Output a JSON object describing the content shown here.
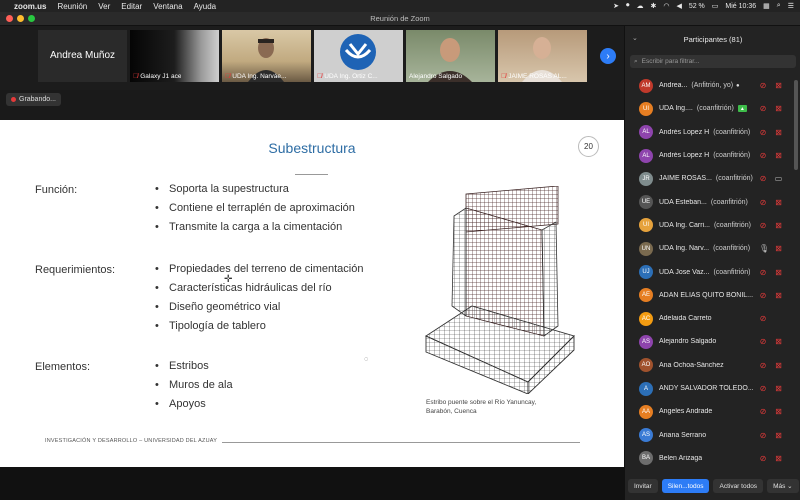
{
  "menubar": {
    "app": "zoom.us",
    "items": [
      "Reunión",
      "Ver",
      "Editar",
      "Ventana",
      "Ayuda"
    ],
    "battery": "52 %",
    "clock": "Mié 10:36"
  },
  "window": {
    "title": "Reunión de Zoom"
  },
  "videos": [
    {
      "name": "Andrea Muñoz",
      "big": true,
      "muted": false
    },
    {
      "name": "Galaxy J1 ace",
      "big": false,
      "muted": true
    },
    {
      "name": "UDA Ing. Narváe...",
      "big": false,
      "muted": true
    },
    {
      "name": "UDA Ing. Ortiz C...",
      "big": false,
      "muted": true
    },
    {
      "name": "Alejandro Salgado",
      "big": false,
      "muted": false
    },
    {
      "name": "JAIME ROSAS AL...",
      "big": false,
      "muted": true
    }
  ],
  "recording": {
    "label": "Grabando..."
  },
  "slide": {
    "title": "Subestructura",
    "page": "20",
    "sections": [
      {
        "label": "Función:",
        "bullets": [
          "Soporta la supestructura",
          "Contiene el terraplén de aproximación",
          "Transmite la carga a la cimentación"
        ]
      },
      {
        "label": "Requerimientos:",
        "bullets": [
          "Propiedades del terreno de cimentación",
          "Características hidráulicas del río",
          "Diseño geométrico vial",
          "Tipología de tablero"
        ]
      },
      {
        "label": "Elementos:",
        "bullets": [
          "Estribos",
          "Muros de ala",
          "Apoyos"
        ]
      }
    ],
    "caption_line1": "Estribo puente sobre el Río Yanuncay,",
    "caption_line2": "Barabón, Cuenca",
    "footer": "INVESTIGACIÓN Y DESARROLLO – UNIVERSIDAD DEL AZUAY"
  },
  "participants": {
    "header": "Participantes (81)",
    "search_placeholder": "Escribir para filtrar...",
    "list": [
      {
        "initials": "AM",
        "color": "#c0392b",
        "name": "Andrea...",
        "role": "(Anfitrión, yo)",
        "mic": "off",
        "cam": "off",
        "extra": "dot"
      },
      {
        "initials": "UI",
        "color": "#e67e22",
        "name": "UDA Ing....",
        "role": "(coanfitrión)",
        "mic": "off",
        "cam": "off",
        "extra": "share"
      },
      {
        "initials": "AL",
        "color": "#8e44ad",
        "name": "Andrés Lopez H",
        "role": "(coanfitrión)",
        "mic": "off",
        "cam": "off",
        "extra": ""
      },
      {
        "initials": "AL",
        "color": "#8e44ad",
        "name": "Andrés Lopez H",
        "role": "(coanfitrión)",
        "mic": "off",
        "cam": "off",
        "extra": ""
      },
      {
        "initials": "JR",
        "color": "#7f8c8d",
        "name": "JAIME ROSAS...",
        "role": "(coanfitrión)",
        "mic": "off",
        "cam": "on",
        "extra": ""
      },
      {
        "initials": "UE",
        "color": "#555555",
        "name": "UDA Esteban...",
        "role": "(coanfitrión)",
        "mic": "off",
        "cam": "off",
        "extra": ""
      },
      {
        "initials": "UI",
        "color": "#e6a23c",
        "name": "UDA Ing. Carri...",
        "role": "(coanfitrión)",
        "mic": "off",
        "cam": "off",
        "extra": ""
      },
      {
        "initials": "UN",
        "color": "#7a6a4f",
        "name": "UDA Ing. Narv...",
        "role": "(coanfitrión)",
        "mic": "on",
        "cam": "off",
        "extra": ""
      },
      {
        "initials": "UJ",
        "color": "#2c6fb7",
        "name": "UDA Jose Vaz...",
        "role": "(coanfitrión)",
        "mic": "off",
        "cam": "off",
        "extra": ""
      },
      {
        "initials": "AE",
        "color": "#e67e22",
        "name": "ADAN ELIAS QUITO BONIL...",
        "role": "",
        "mic": "off",
        "cam": "off",
        "extra": ""
      },
      {
        "initials": "AC",
        "color": "#f39c12",
        "name": "Adelaida Carreto",
        "role": "",
        "mic": "off",
        "cam": "none",
        "extra": ""
      },
      {
        "initials": "AS",
        "color": "#8e44ad",
        "name": "Alejandro Salgado",
        "role": "",
        "mic": "off",
        "cam": "off",
        "extra": ""
      },
      {
        "initials": "AO",
        "color": "#a0522d",
        "name": "Ana Ochoa-Sánchez",
        "role": "",
        "mic": "off",
        "cam": "off",
        "extra": ""
      },
      {
        "initials": "A",
        "color": "#2c6fb7",
        "name": "ANDY SALVADOR TOLEDO...",
        "role": "",
        "mic": "off",
        "cam": "off",
        "extra": ""
      },
      {
        "initials": "AA",
        "color": "#e67e22",
        "name": "Angeles Andrade",
        "role": "",
        "mic": "off",
        "cam": "off",
        "extra": ""
      },
      {
        "initials": "AS",
        "color": "#3a7bd5",
        "name": "Ariana Serrano",
        "role": "",
        "mic": "off",
        "cam": "off",
        "extra": ""
      },
      {
        "initials": "BA",
        "color": "#6d6d6d",
        "name": "Belen Arizaga",
        "role": "",
        "mic": "off",
        "cam": "off",
        "extra": ""
      }
    ],
    "buttons": {
      "invite": "Invitar",
      "mute_all": "Silen...todos",
      "unmute_all": "Activar todos",
      "more": "Más"
    }
  }
}
